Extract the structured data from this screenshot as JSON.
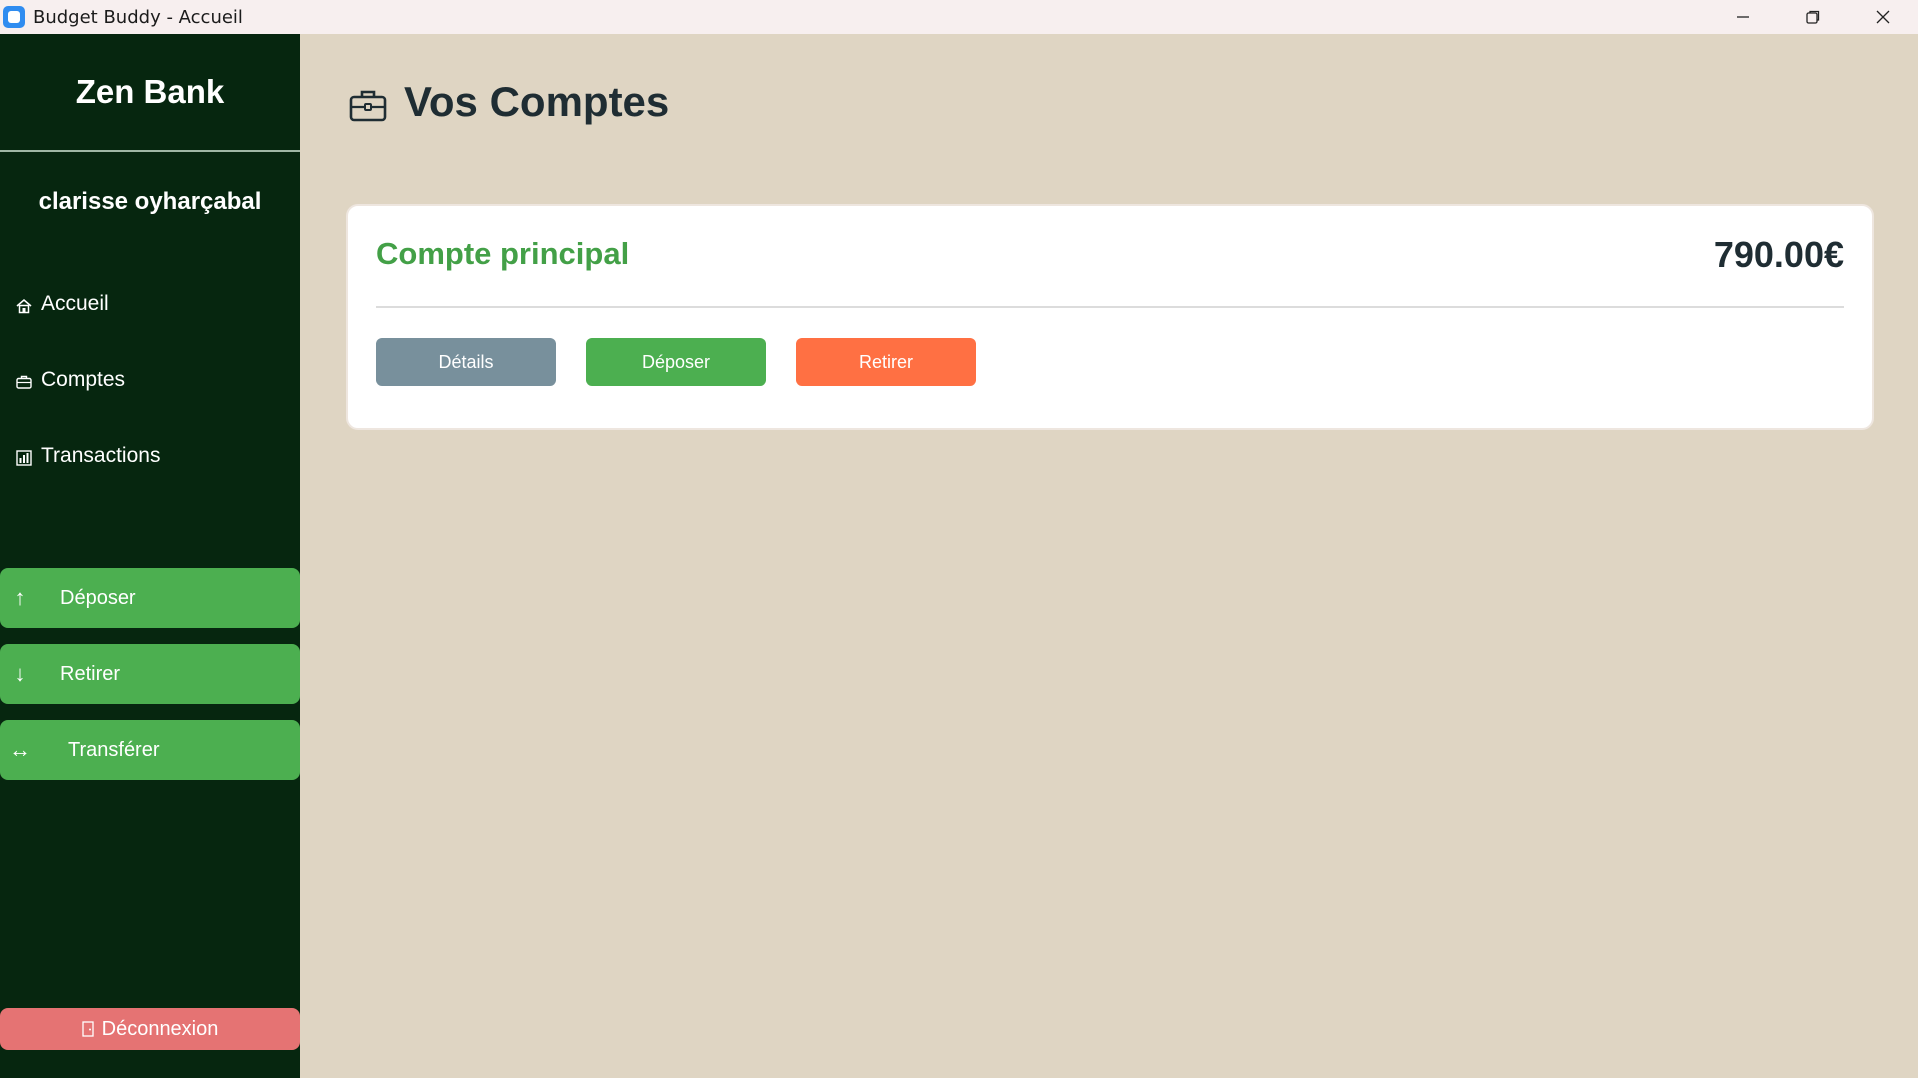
{
  "window": {
    "title": "Budget Buddy - Accueil"
  },
  "sidebar": {
    "brand": "Zen Bank",
    "username": "clarisse oyharçabal",
    "nav": [
      {
        "label": "Accueil",
        "icon": "home-icon"
      },
      {
        "label": "Comptes",
        "icon": "briefcase-icon"
      },
      {
        "label": "Transactions",
        "icon": "bar-chart-icon"
      }
    ],
    "actions": [
      {
        "label": "Déposer",
        "icon": "arrow-up-icon",
        "glyph": "↑"
      },
      {
        "label": "Retirer",
        "icon": "arrow-down-icon",
        "glyph": "↓"
      },
      {
        "label": "Transférer",
        "icon": "arrows-horizontal-icon",
        "glyph": "↔"
      }
    ],
    "logout": {
      "label": "Déconnexion",
      "icon": "door-icon"
    }
  },
  "main": {
    "title": "Vos Comptes",
    "title_icon": "briefcase-icon",
    "accounts": [
      {
        "name": "Compte principal",
        "balance": "790.00€",
        "buttons": {
          "details": "Détails",
          "deposit": "Déposer",
          "withdraw": "Retirer"
        }
      }
    ]
  },
  "colors": {
    "sidebar_bg": "#06260f",
    "main_bg": "#dfd5c3",
    "accent_green": "#4caf50",
    "details_grey": "#78909c",
    "withdraw_orange": "#ff7043",
    "logout_red": "#e57373"
  }
}
